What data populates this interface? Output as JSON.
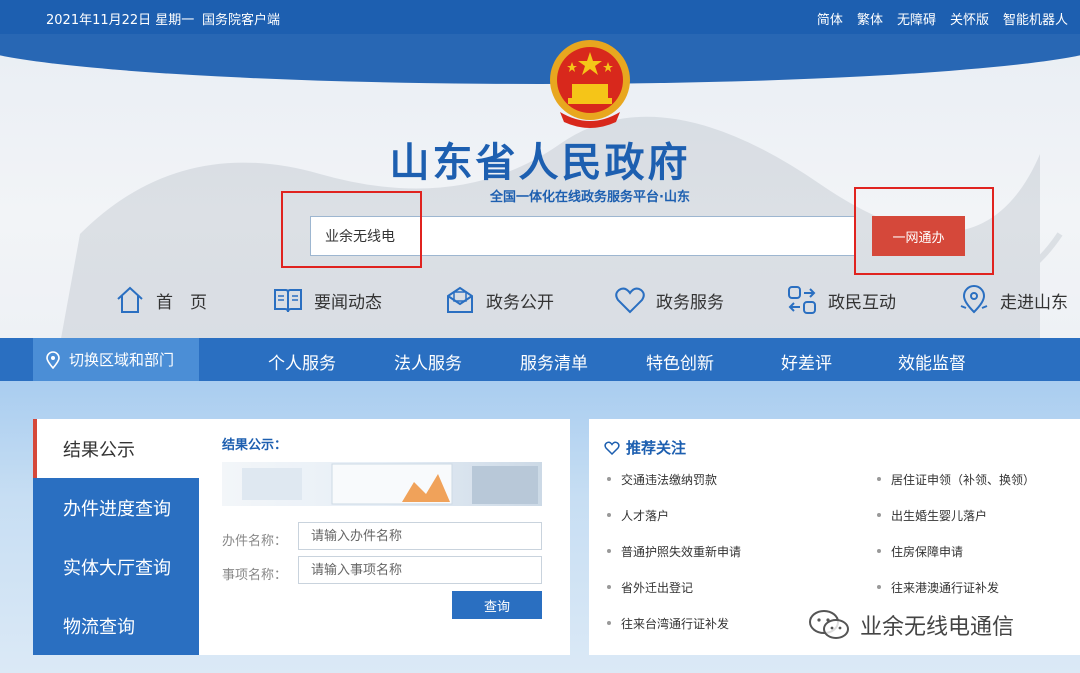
{
  "topbar": {
    "date": "2021年11月22日 星期一",
    "client": "国务院客户端",
    "links": [
      "简体",
      "繁体",
      "无障碍",
      "关怀版",
      "智能机器人"
    ]
  },
  "header": {
    "title": "山东省人民政府",
    "subtitle": "全国一体化在线政务服务平台·山东",
    "search_value": "业余无线电",
    "search_button": "一网通办"
  },
  "quicknav": [
    {
      "label": "首　页",
      "icon": "home-icon"
    },
    {
      "label": "要闻动态",
      "icon": "news-icon"
    },
    {
      "label": "政务公开",
      "icon": "mail-icon"
    },
    {
      "label": "政务服务",
      "icon": "heart-icon"
    },
    {
      "label": "政民互动",
      "icon": "interact-icon"
    },
    {
      "label": "走进山东",
      "icon": "location-icon"
    }
  ],
  "mainnav": {
    "region": "切换区域和部门",
    "items": [
      "个人服务",
      "法人服务",
      "服务清单",
      "特色创新",
      "好差评",
      "效能监督"
    ]
  },
  "tabs": [
    "结果公示",
    "办件进度查询",
    "实体大厅查询",
    "物流查询"
  ],
  "form": {
    "title": "结果公示：",
    "fields": [
      {
        "label": "办件名称：",
        "placeholder": "请输入办件名称"
      },
      {
        "label": "事项名称：",
        "placeholder": "请输入事项名称"
      }
    ],
    "query_button": "查询"
  },
  "recommend": {
    "title": "推荐关注",
    "left": [
      "交通违法缴纳罚款",
      "人才落户",
      "普通护照失效重新申请",
      "省外迁出登记",
      "往来台湾通行证补发"
    ],
    "right": [
      "居住证申领（补领、换领）",
      "出生婚生婴儿落户",
      "住房保障申请",
      "往来港澳通行证补发"
    ]
  },
  "watermark": "业余无线电通信",
  "colors": {
    "brand_blue": "#1d5fb0",
    "nav_blue": "#2a6fc1",
    "accent_red": "#d5483a",
    "annotation_red": "#e0231f"
  }
}
